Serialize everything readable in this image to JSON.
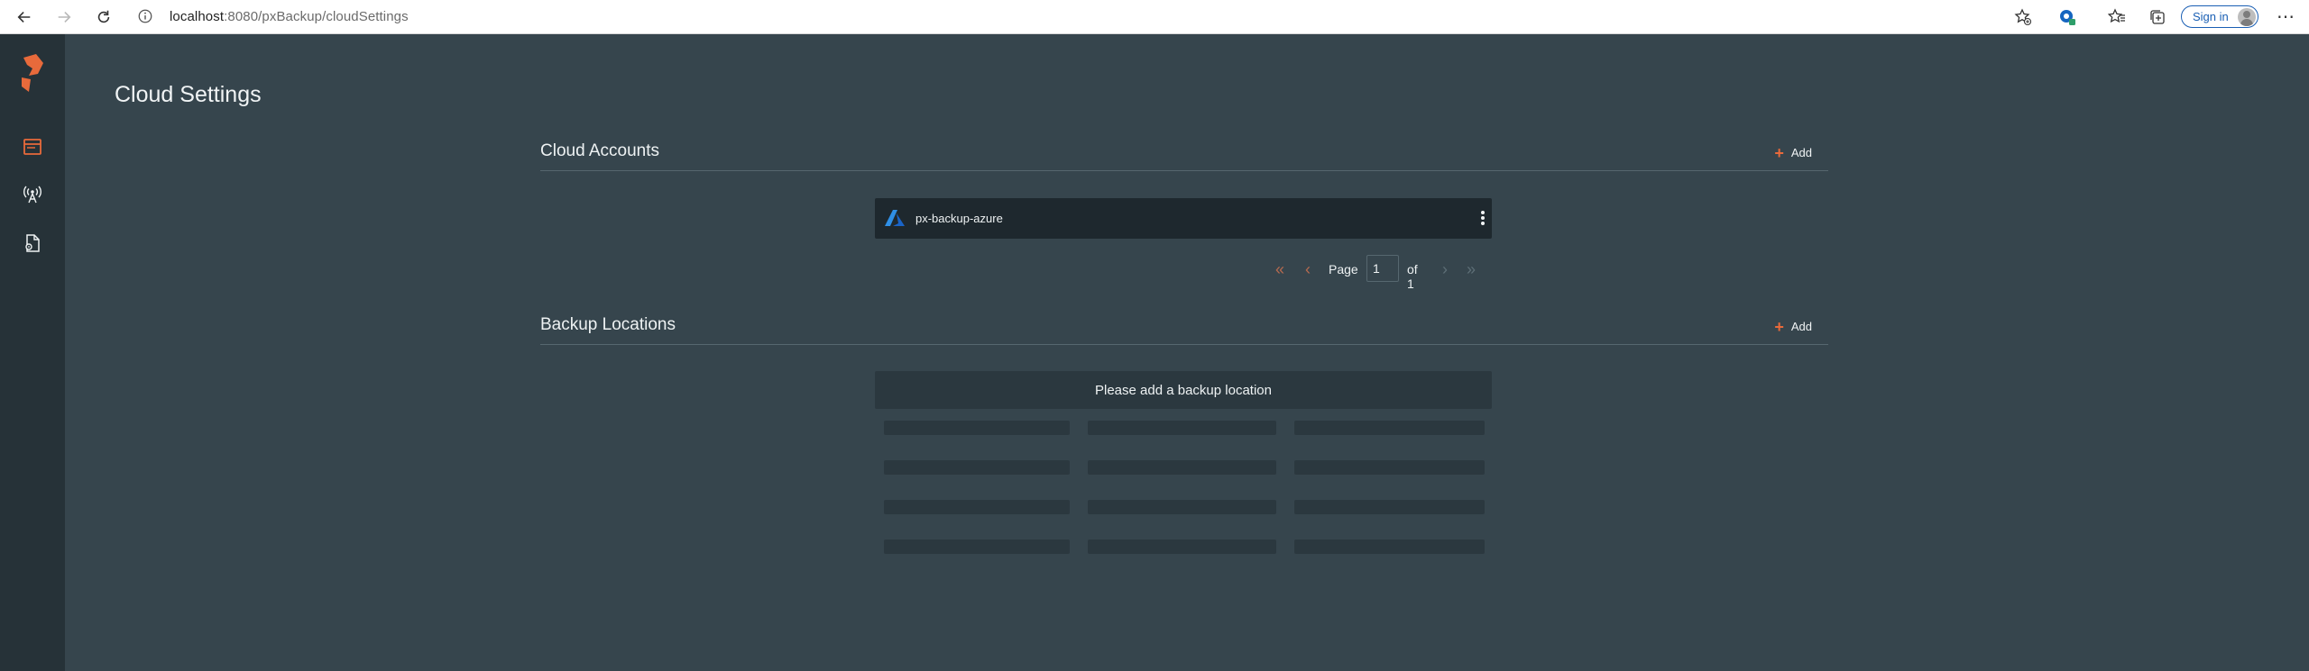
{
  "browser": {
    "url_host": "localhost",
    "url_rest": ":8080/pxBackup/cloudSettings",
    "sign_in_label": "Sign in",
    "more_label": "⋯"
  },
  "sidebar": {
    "items": [
      {
        "name": "dashboard",
        "icon": "browser-window-icon",
        "active": true
      },
      {
        "name": "backup",
        "icon": "antenna-icon",
        "active": false
      },
      {
        "name": "settings",
        "icon": "document-gear-icon",
        "active": false
      }
    ]
  },
  "page": {
    "title": "Cloud Settings"
  },
  "cloud_accounts": {
    "title": "Cloud Accounts",
    "add_label": "Add",
    "accounts": [
      {
        "name": "px-backup-azure",
        "provider_icon": "azure-icon"
      }
    ],
    "pager": {
      "page_label": "Page",
      "page_value": "1",
      "of_label": "of 1"
    }
  },
  "backup_locations": {
    "title": "Backup Locations",
    "add_label": "Add",
    "empty_message": "Please add a backup location"
  },
  "colors": {
    "background": "#36454d",
    "sidebar": "#263238",
    "accent": "#e86a3b",
    "card": "#1e282e"
  }
}
